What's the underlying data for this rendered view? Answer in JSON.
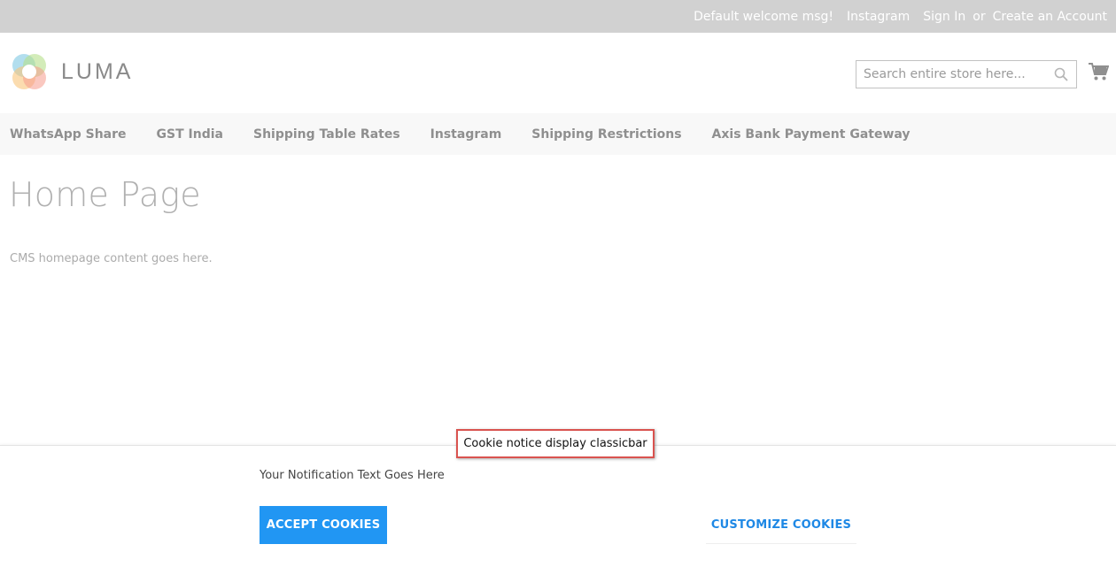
{
  "top_bar": {
    "welcome": "Default welcome msg!",
    "instagram": "Instagram",
    "sign_in": "Sign In",
    "or": "or",
    "create_account": "Create an Account"
  },
  "header": {
    "logo_text": "LUMA",
    "search_placeholder": "Search entire store here..."
  },
  "nav": {
    "items": [
      {
        "label": "WhatsApp Share"
      },
      {
        "label": "GST India"
      },
      {
        "label": "Shipping Table Rates"
      },
      {
        "label": "Instagram"
      },
      {
        "label": "Shipping Restrictions"
      },
      {
        "label": "Axis Bank Payment Gateway"
      }
    ]
  },
  "main": {
    "title": "Home Page",
    "content": "CMS homepage content goes here."
  },
  "cookie_bar": {
    "text": "Your Notification Text Goes Here",
    "accept_label": "ACCEPT COOKIES",
    "customize_label": "CUSTOMIZE COOKIES",
    "annotation": "Cookie notice display classicbar"
  },
  "colors": {
    "accent": "#2196f3",
    "annotation_border": "#d9534f"
  },
  "icons": [
    "luma-logo-icon",
    "search-icon",
    "cart-icon"
  ]
}
